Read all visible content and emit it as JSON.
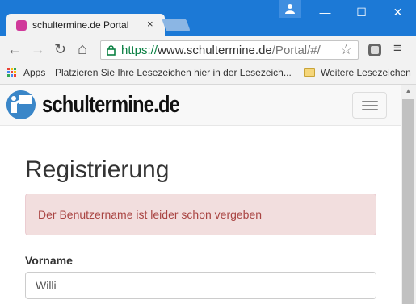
{
  "browser": {
    "tab_title": "schultermine.de Portal",
    "tab_close": "×",
    "window_controls": {
      "minimize": "—",
      "maximize": "☐",
      "close": "✕"
    },
    "nav": {
      "back": "←",
      "forward": "→",
      "reload": "↻",
      "home": "⌂"
    },
    "url": {
      "scheme": "https://",
      "host": "www.schultermine.de",
      "path": "/Portal/#/"
    },
    "star": "☆",
    "menu": "≡"
  },
  "bookmarks": {
    "apps_label": "Apps",
    "hint": "Platzieren Sie Ihre Lesezeichen hier in der Lesezeich...",
    "more": "Weitere Lesezeichen"
  },
  "site": {
    "logo_text": "schultermine.de"
  },
  "form": {
    "heading": "Registrierung",
    "alert": "Der Benutzername ist leider schon vergeben",
    "first_name_label": "Vorname",
    "first_name_value": "Willi"
  },
  "colors": {
    "titlebar": "#1c79d6",
    "alert_bg": "#f2dede",
    "alert_text": "#a94442",
    "url_scheme": "#0b8043"
  }
}
